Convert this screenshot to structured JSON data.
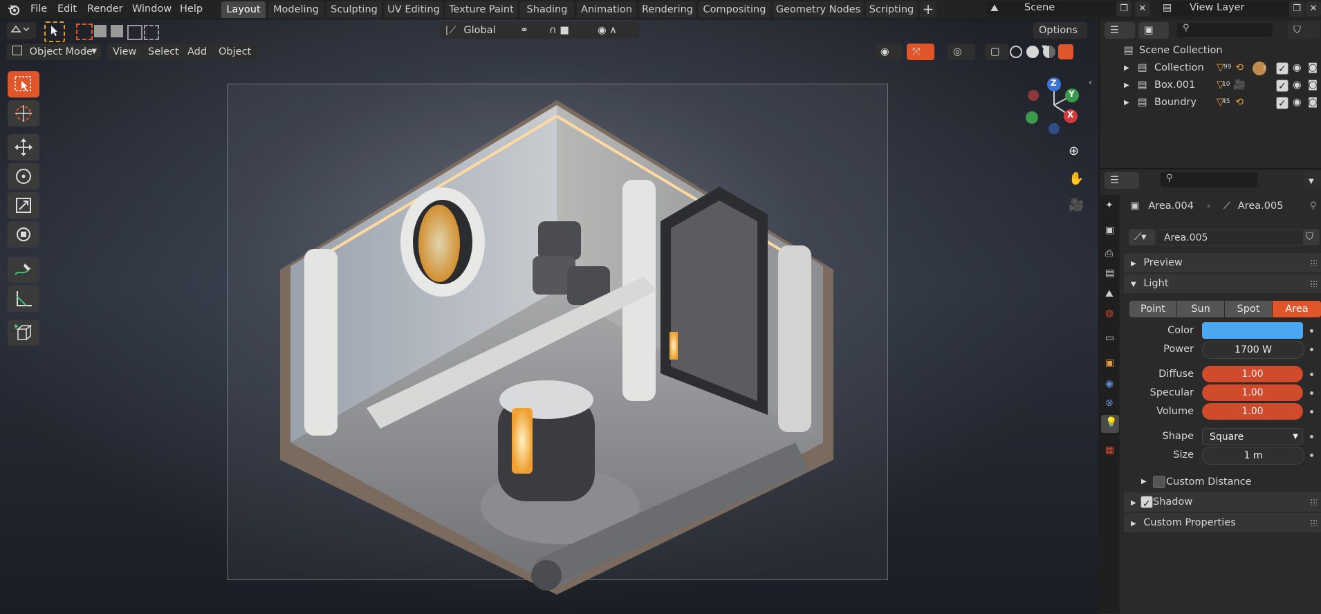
{
  "menubar": {
    "items": [
      "File",
      "Edit",
      "Render",
      "Window",
      "Help"
    ]
  },
  "workspace_tabs": [
    "Layout",
    "Modeling",
    "Sculpting",
    "UV Editing",
    "Texture Paint",
    "Shading",
    "Animation",
    "Rendering",
    "Compositing",
    "Geometry Nodes",
    "Scripting"
  ],
  "active_workspace": "Layout",
  "scene": {
    "name": "Scene"
  },
  "view_layer": {
    "name": "View Layer"
  },
  "tool_header": {
    "transform_orientation": "Global",
    "options_label": "Options"
  },
  "viewport_header": {
    "mode": "Object Mode",
    "menus": [
      "View",
      "Select",
      "Add",
      "Object"
    ]
  },
  "navigation_gizmo": {
    "axes": [
      "Z",
      "Y",
      "X"
    ]
  },
  "outliner": {
    "root": "Scene Collection",
    "items": [
      {
        "label": "Collection",
        "badge_a": "99",
        "badge_b": "7"
      },
      {
        "label": "Box.001",
        "badge_a": "10",
        "badge_b": ""
      },
      {
        "label": "Boundry",
        "badge_a": "45",
        "badge_b": ""
      }
    ]
  },
  "properties": {
    "object_name": "Area.004",
    "data_name": "Area.005",
    "datablock_name": "Area.005",
    "panels": {
      "preview": "Preview",
      "light": "Light",
      "custom_distance": "Custom Distance",
      "shadow": "Shadow",
      "custom_properties": "Custom Properties"
    },
    "light_types": [
      "Point",
      "Sun",
      "Spot",
      "Area"
    ],
    "active_light_type": "Area",
    "color_label": "Color",
    "color_value": "#4aa7f0",
    "power_label": "Power",
    "power_value": "1700 W",
    "diffuse_label": "Diffuse",
    "diffuse_value": "1.00",
    "specular_label": "Specular",
    "specular_value": "1.00",
    "volume_label": "Volume",
    "volume_value": "1.00",
    "shape_label": "Shape",
    "shape_value": "Square",
    "size_label": "Size",
    "size_value": "1 m",
    "custom_distance_enabled": false,
    "shadow_enabled": true
  },
  "colors": {
    "accent": "#e0552a",
    "light_color_swatch": "#4aa7f0",
    "panel_bg": "#2a2a2a"
  }
}
